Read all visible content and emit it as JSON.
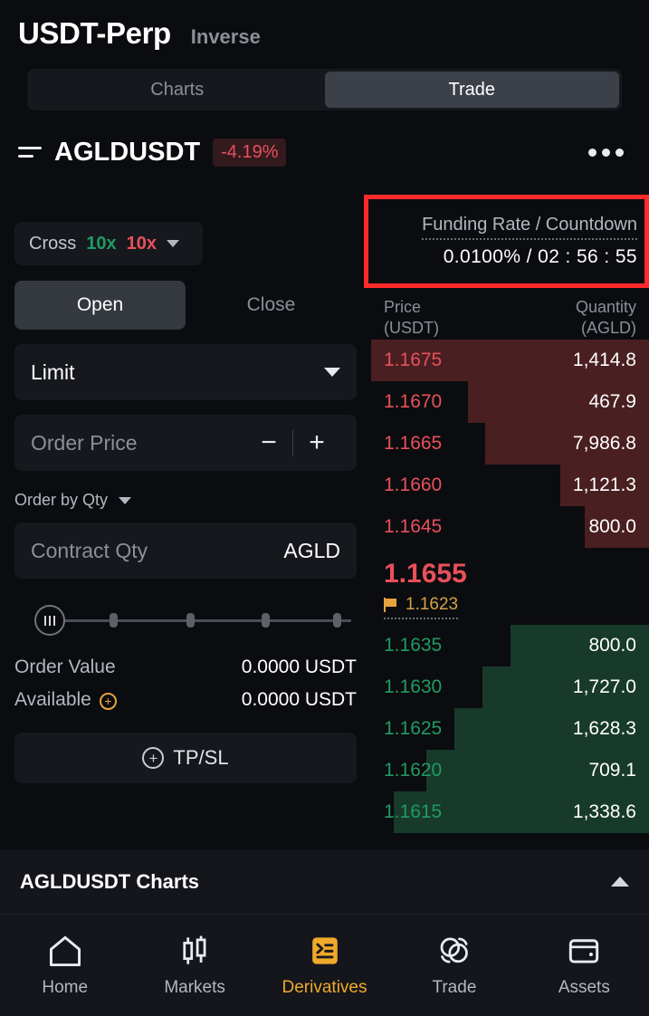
{
  "header": {
    "title": "USDT-Perp",
    "subtitle": "Inverse"
  },
  "segmented": {
    "charts": "Charts",
    "trade": "Trade",
    "active": "Trade"
  },
  "symbol": {
    "icon": "list-icon",
    "name": "AGLDUSDT",
    "change": "-4.19%",
    "change_color": "#e8505b",
    "menu_icon": "more-dots-icon"
  },
  "funding": {
    "label": "Funding Rate / Countdown",
    "value": "0.0100% / 02 : 56 : 55",
    "highlight_color": "#ff2a2a"
  },
  "leverage": {
    "margin_mode": "Cross",
    "long": "10x",
    "short": "10x"
  },
  "order_form": {
    "open_label": "Open",
    "close_label": "Close",
    "active_side": "Open",
    "order_type": "Limit",
    "price_placeholder": "Order Price",
    "minus_label": "−",
    "plus_label": "+",
    "order_by_label": "Order by Qty",
    "qty_placeholder": "Contract Qty",
    "qty_unit": "AGLD",
    "order_value_label": "Order Value",
    "order_value": "0.0000 USDT",
    "available_label": "Available",
    "available_value": "0.0000 USDT",
    "tpsl_label": "TP/SL"
  },
  "orderbook": {
    "price_header_line1": "Price",
    "price_header_line2": "(USDT)",
    "qty_header_line1": "Quantity",
    "qty_header_line2": "(AGLD)",
    "ask_color": "#e8505b",
    "bid_color": "#1f9b63",
    "asks": [
      {
        "price": "1.1675",
        "qty": "1,414.8",
        "depth": 100
      },
      {
        "price": "1.1670",
        "qty": "467.9",
        "depth": 65
      },
      {
        "price": "1.1665",
        "qty": "7,986.8",
        "depth": 59
      },
      {
        "price": "1.1660",
        "qty": "1,121.3",
        "depth": 32
      },
      {
        "price": "1.1645",
        "qty": "800.0",
        "depth": 23
      }
    ],
    "last_price": "1.1655",
    "mark_price": "1.1623",
    "bids": [
      {
        "price": "1.1635",
        "qty": "800.0",
        "depth": 50
      },
      {
        "price": "1.1630",
        "qty": "1,727.0",
        "depth": 60
      },
      {
        "price": "1.1625",
        "qty": "1,628.3",
        "depth": 70
      },
      {
        "price": "1.1620",
        "qty": "709.1",
        "depth": 80
      },
      {
        "price": "1.1615",
        "qty": "1,338.6",
        "depth": 92
      }
    ]
  },
  "charts_strip": {
    "title": "AGLDUSDT Charts",
    "toggle_icon": "chevron-up-icon"
  },
  "bottom_nav": {
    "active": "Derivatives",
    "items": [
      {
        "label": "Home",
        "icon": "home-icon"
      },
      {
        "label": "Markets",
        "icon": "candlestick-icon"
      },
      {
        "label": "Derivatives",
        "icon": "derivatives-icon"
      },
      {
        "label": "Trade",
        "icon": "swap-icon"
      },
      {
        "label": "Assets",
        "icon": "wallet-icon"
      }
    ]
  }
}
